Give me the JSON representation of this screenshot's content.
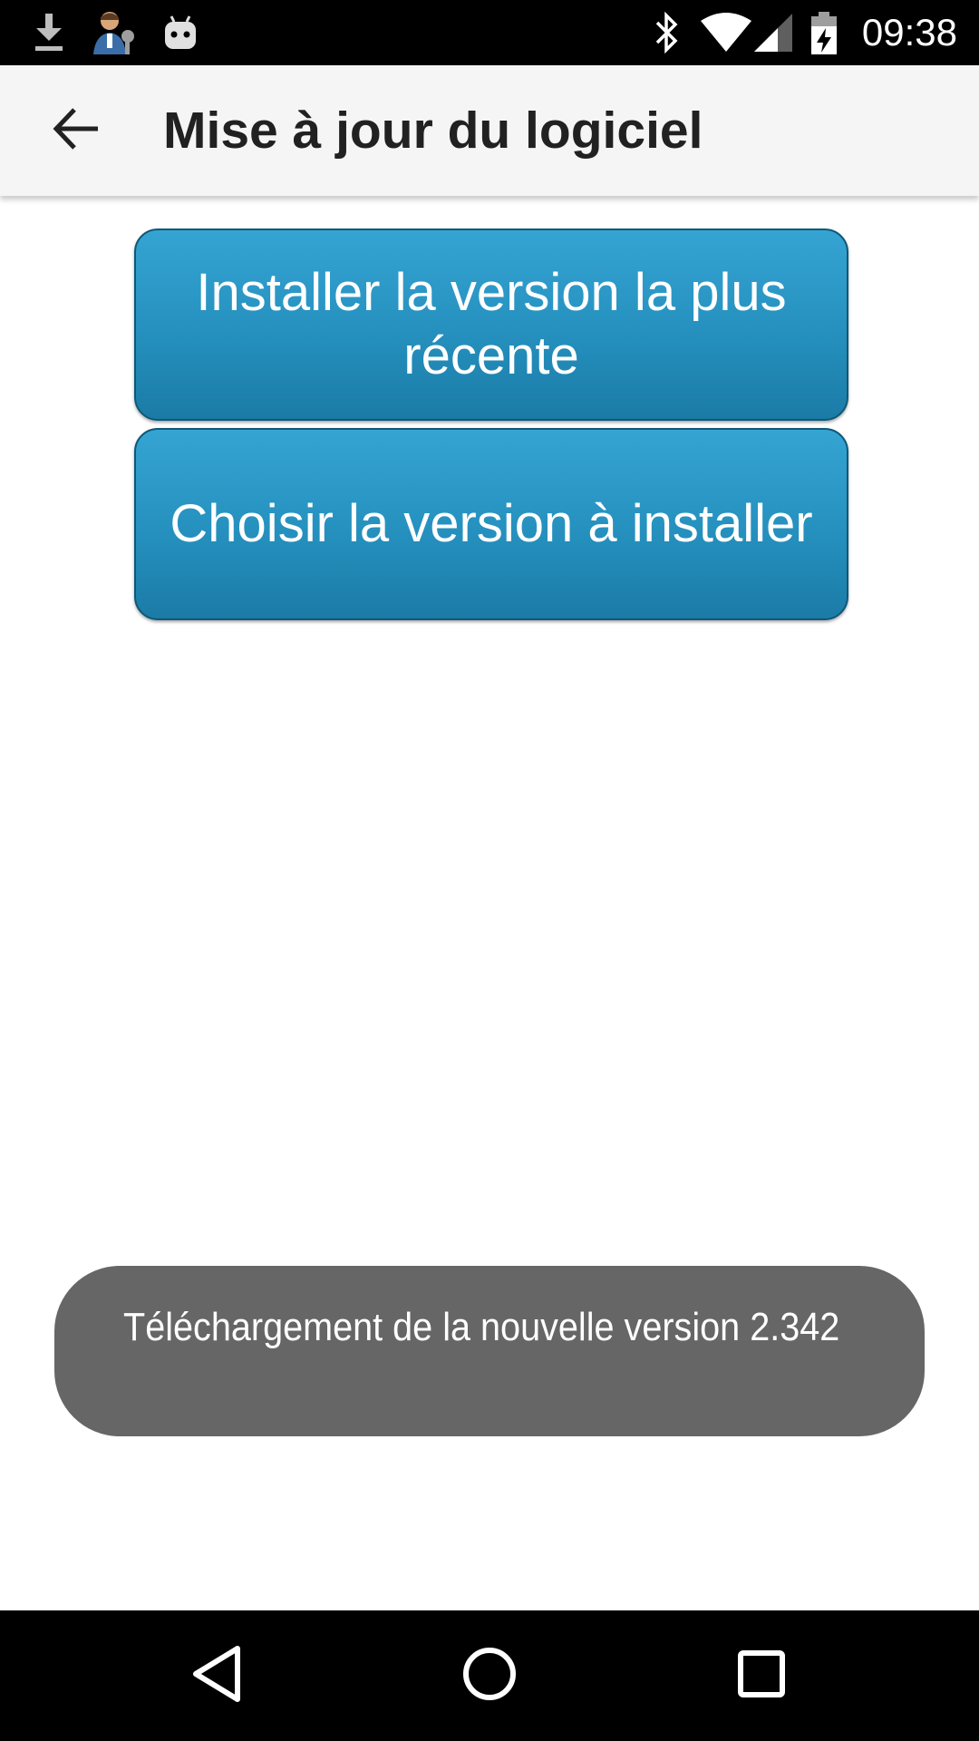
{
  "status_bar": {
    "time": "09:38",
    "left_icons": [
      "download-icon",
      "user-assistant-icon",
      "android-robot-icon"
    ],
    "right_icons": [
      "bluetooth-icon",
      "wifi-icon",
      "cell-signal-icon",
      "battery-charging-icon"
    ]
  },
  "app_bar": {
    "title": "Mise à jour du logiciel",
    "back_icon": "arrow-back-icon"
  },
  "actions": {
    "install_latest_label": "Installer la version la plus récente",
    "choose_version_label": "Choisir la version à installer"
  },
  "toast": {
    "message": "Téléchargement de la nouvelle version 2.342"
  },
  "nav_bar": {
    "icons": [
      "back-triangle-icon",
      "home-circle-icon",
      "recents-square-icon"
    ]
  },
  "colors": {
    "button_top": "#35a4d3",
    "button_bottom": "#1b7ba6",
    "button_border": "#0e5877",
    "app_bar_bg": "#f5f5f5",
    "toast_bg": "#666666"
  }
}
